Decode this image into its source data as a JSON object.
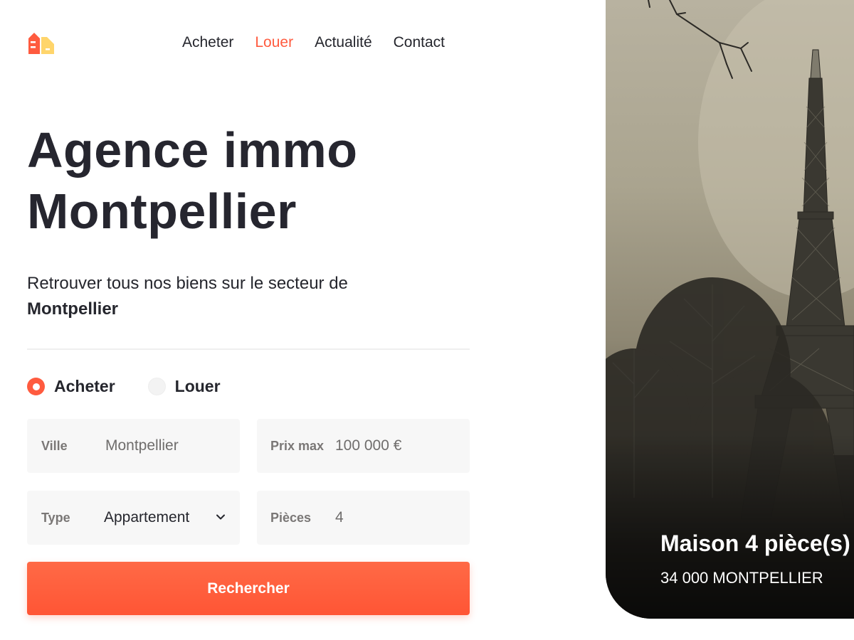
{
  "nav": {
    "items": [
      {
        "label": "Acheter",
        "active": false
      },
      {
        "label": "Louer",
        "active": true
      },
      {
        "label": "Actualité",
        "active": false
      },
      {
        "label": "Contact",
        "active": false
      }
    ]
  },
  "hero": {
    "title_line1": "Agence immo",
    "title_line2": "Montpellier",
    "subtitle": "Retrouver tous nos biens sur le secteur de",
    "subtitle_bold": "Montpellier"
  },
  "search": {
    "mode_options": [
      {
        "label": "Acheter",
        "selected": true
      },
      {
        "label": "Louer",
        "selected": false
      }
    ],
    "ville": {
      "label": "Ville",
      "value": "Montpellier"
    },
    "prix": {
      "label": "Prix max",
      "value": "100 000 €"
    },
    "type": {
      "label": "Type",
      "value": "Appartement"
    },
    "pieces": {
      "label": "Pièces",
      "value": "4"
    },
    "submit_label": "Rechercher"
  },
  "listing": {
    "title": "Maison 4 pièce(s)",
    "location": "34 000 MONTPELLIER"
  },
  "colors": {
    "accent": "#ff5b3f",
    "logo_yellow": "#ffd56b",
    "text": "#25262d"
  }
}
